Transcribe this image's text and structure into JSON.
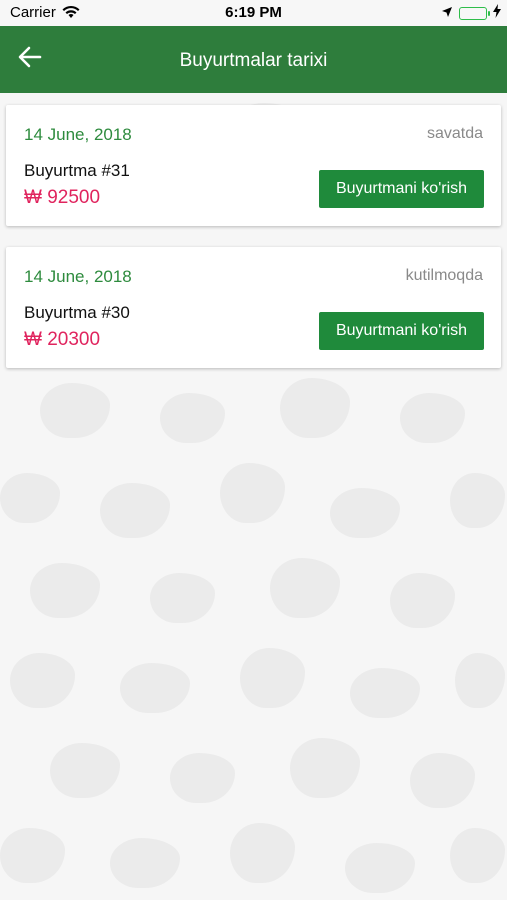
{
  "status_bar": {
    "carrier": "Carrier",
    "time": "6:19 PM"
  },
  "header": {
    "title": "Buyurtmalar tarixi",
    "back_icon": "arrow-left-icon"
  },
  "orders": [
    {
      "date": "14 June, 2018",
      "status": "savatda",
      "order_label": "Buyurtma #31",
      "price": "₩ 92500",
      "button_label": "Buyurtmani ko'rish"
    },
    {
      "date": "14 June, 2018",
      "status": "kutilmoqda",
      "order_label": "Buyurtma #30",
      "price": "₩ 20300",
      "button_label": "Buyurtmani ko'rish"
    }
  ],
  "colors": {
    "header": "#2e7d3c",
    "accent_green": "#2e8b3e",
    "button": "#1f8a3b",
    "price": "#e0245e",
    "status_gray": "#8a8a8a"
  }
}
